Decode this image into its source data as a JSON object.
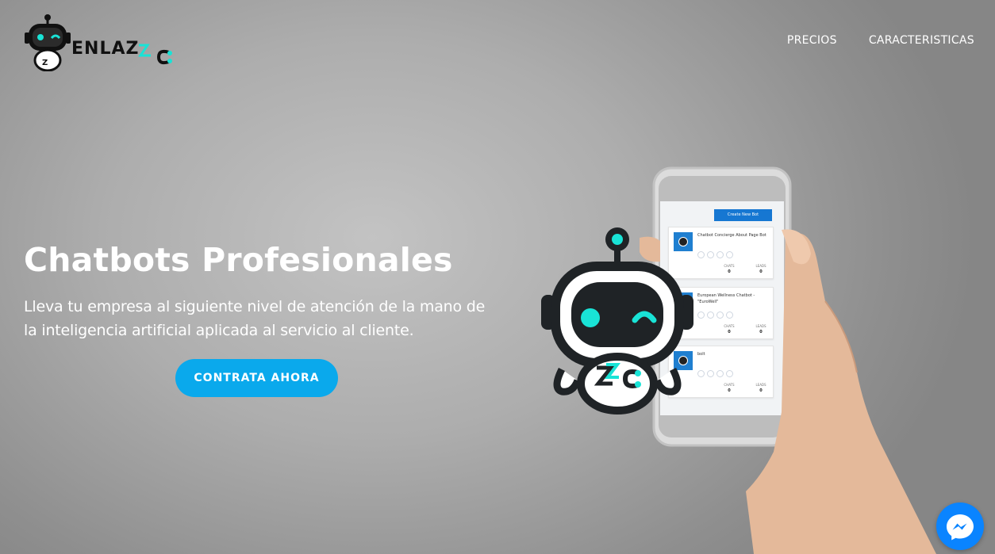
{
  "header": {
    "brand": "ENLAZ",
    "nav": [
      {
        "label": "PRECIOS"
      },
      {
        "label": "CARACTERISTICAS"
      }
    ]
  },
  "hero": {
    "title": "Chatbots Profesionales",
    "subtitle": "Lleva tu empresa al siguiente nivel de atención de la mano de la inteligencia artificial aplicada al servicio al cliente.",
    "cta_label": "CONTRATA AHORA"
  },
  "phone": {
    "create_label": "Create New Bot",
    "bots": [
      {
        "name": "Chatbot Concierge About Page Bot",
        "chats_label": "CHATS",
        "chats": "0",
        "leads_label": "LEADS",
        "leads": "0"
      },
      {
        "name": "European Wellness Chatbot - \"EuroWell\"",
        "chats_label": "CHATS",
        "chats": "0",
        "leads_label": "LEADS",
        "leads": "0"
      },
      {
        "name": "bolt",
        "chats_label": "CHATS",
        "chats": "0",
        "leads_label": "LEADS",
        "leads": "0"
      }
    ]
  },
  "colors": {
    "accent": "#0aa9ec",
    "brand_cyan": "#19e3d6",
    "messenger": "#0a84ff"
  },
  "icons": {
    "logo": "robot-logo-icon",
    "mascot": "robot-mascot-icon",
    "chat_widget": "messenger-icon"
  }
}
